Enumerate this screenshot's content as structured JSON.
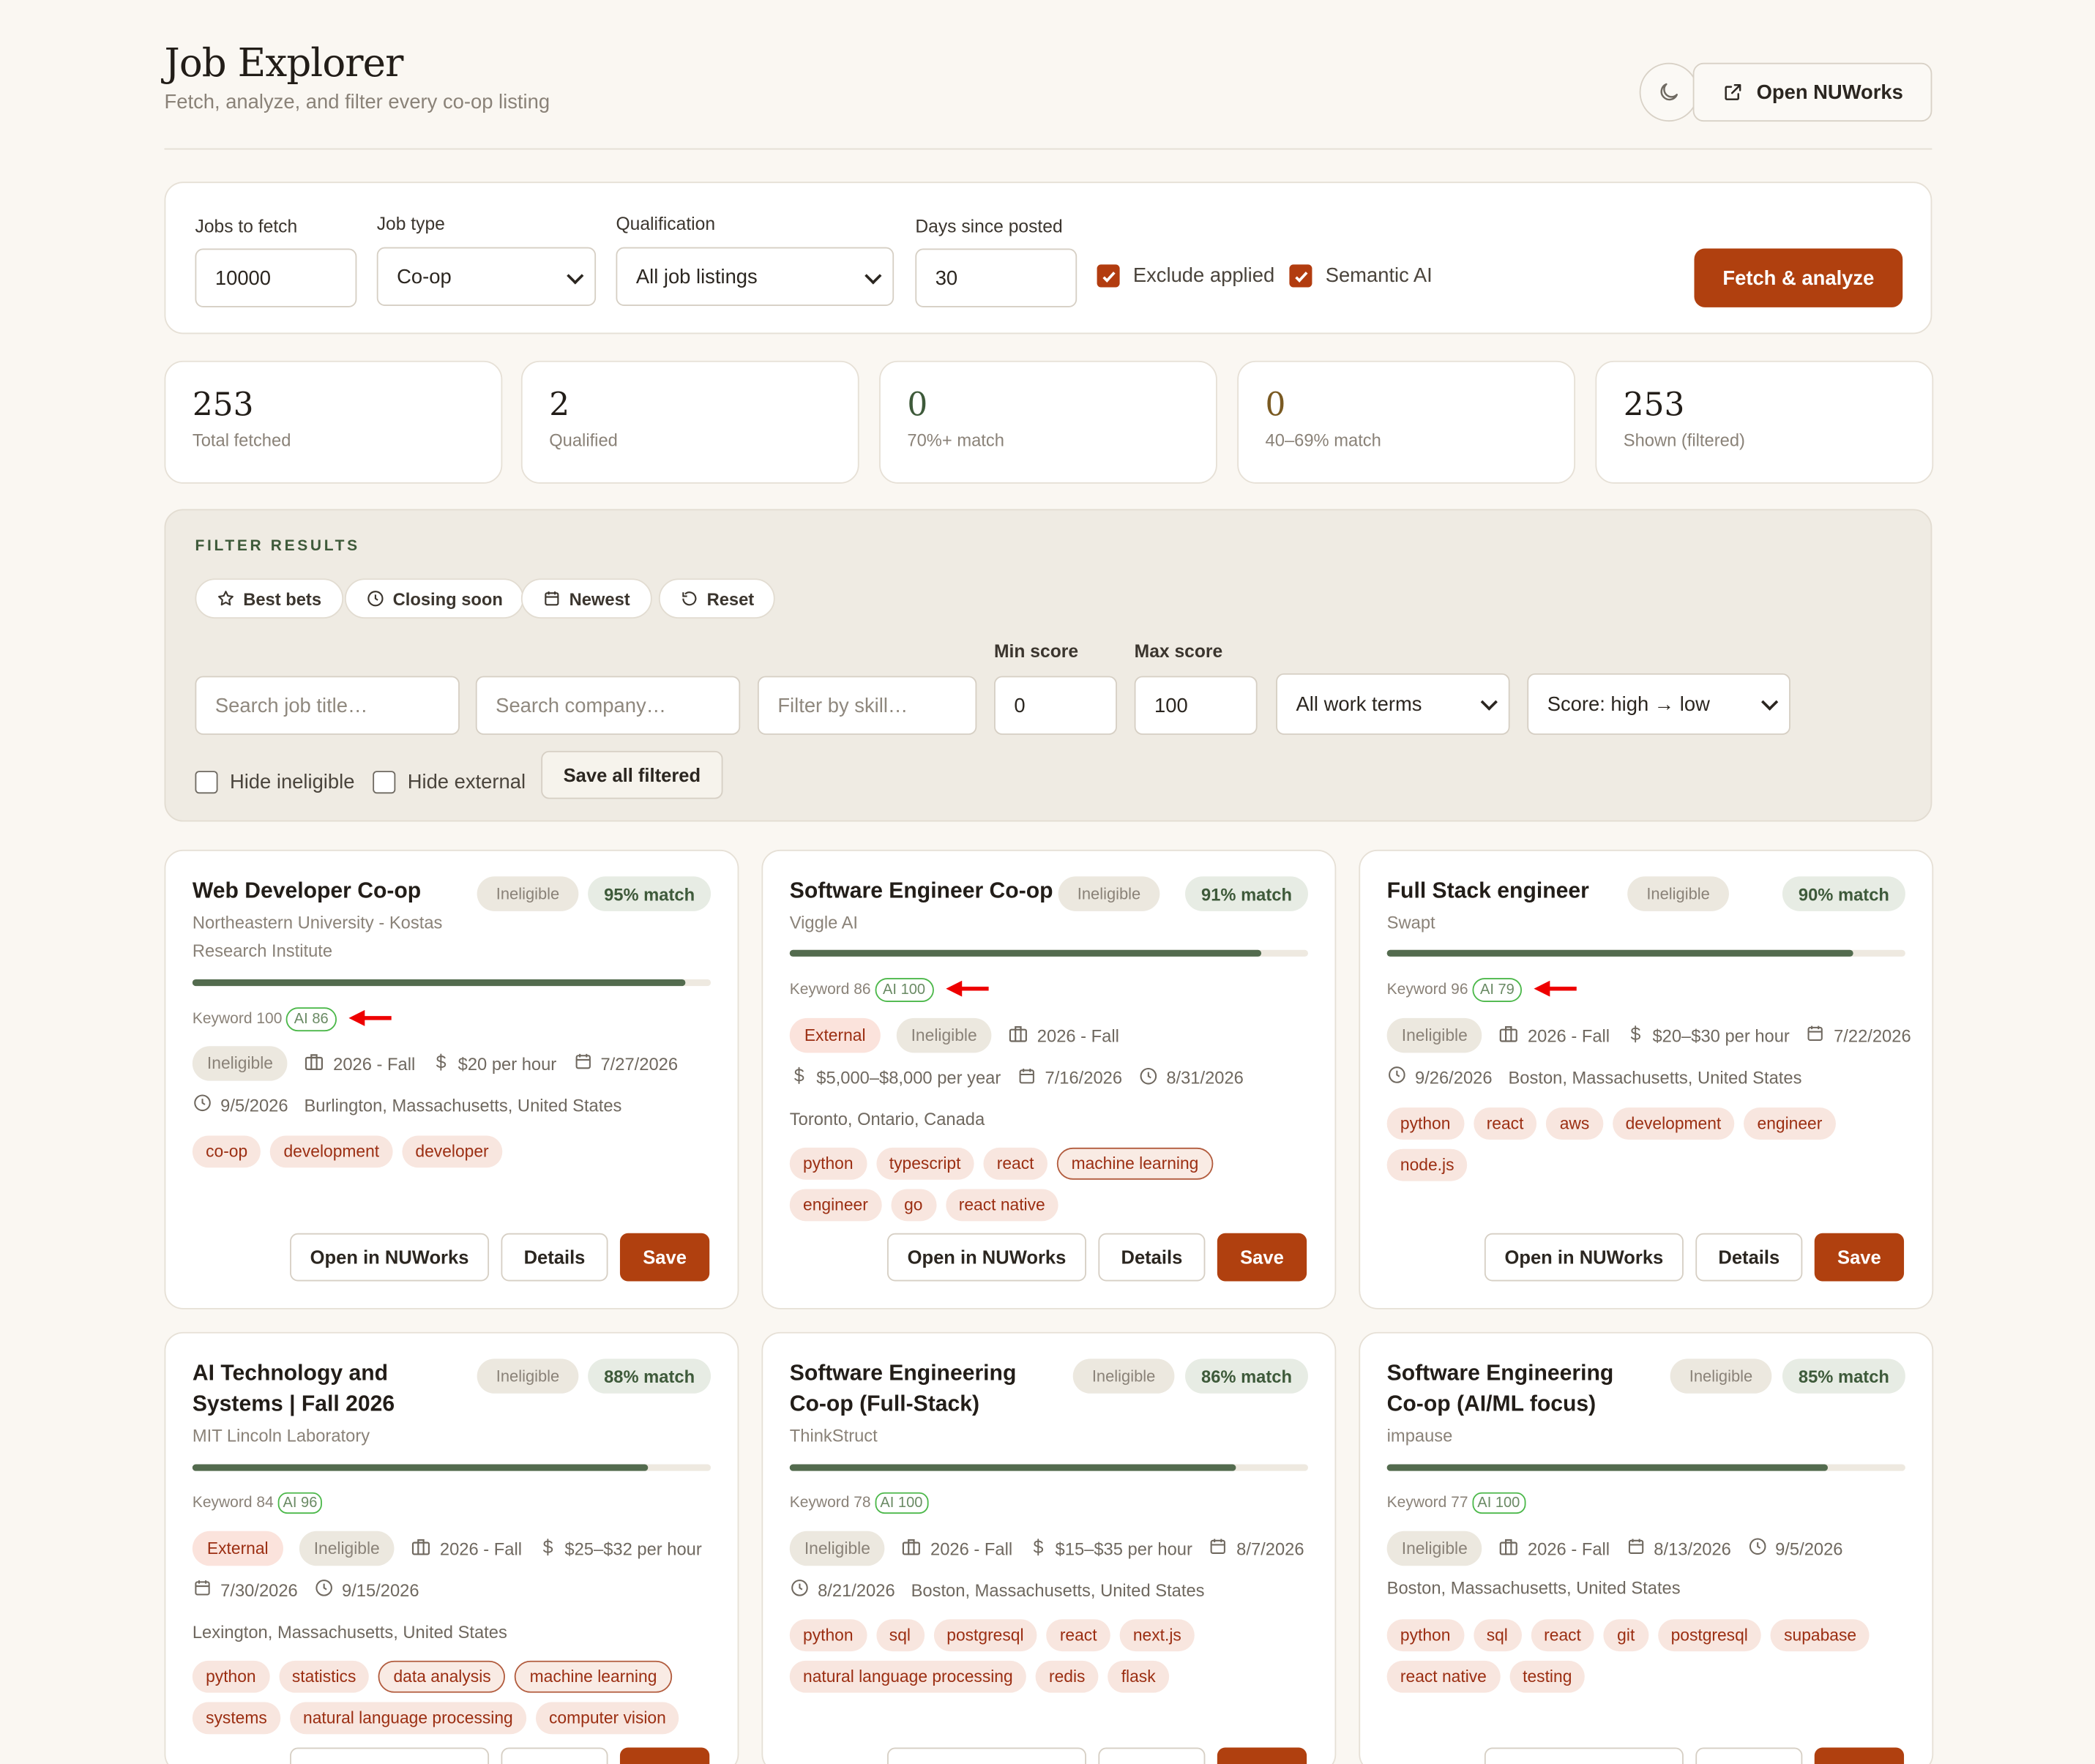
{
  "header": {
    "title": "Job Explorer",
    "subtitle": "Fetch, analyze, and filter every co-op listing",
    "open_button": "Open NUWorks",
    "theme_icon": "moon-icon"
  },
  "fetch": {
    "jobs_to_fetch_label": "Jobs to fetch",
    "jobs_to_fetch_value": "10000",
    "job_type_label": "Job type",
    "job_type_value": "Co-op",
    "qualification_label": "Qualification",
    "qualification_value": "All job listings",
    "days_label": "Days since posted",
    "days_value": "30",
    "exclude_applied_label": "Exclude applied",
    "exclude_applied_checked": true,
    "semantic_ai_label": "Semantic AI",
    "semantic_ai_checked": true,
    "fetch_button": "Fetch & analyze"
  },
  "stats": [
    {
      "value": "253",
      "label": "Total fetched"
    },
    {
      "value": "2",
      "label": "Qualified"
    },
    {
      "value": "0",
      "label": "70%+ match"
    },
    {
      "value": "0",
      "label": "40–69% match"
    },
    {
      "value": "253",
      "label": "Shown (filtered)"
    }
  ],
  "filters": {
    "title": "FILTER RESULTS",
    "chips": [
      "Best bets",
      "Closing soon",
      "Newest",
      "Reset"
    ],
    "search_title_placeholder": "Search job title…",
    "search_company_placeholder": "Search company…",
    "filter_skill_placeholder": "Filter by skill…",
    "min_score_label": "Min score",
    "min_score_value": "0",
    "max_score_label": "Max score",
    "max_score_value": "100",
    "work_terms_value": "All work terms",
    "sort_value": "Score: high → low",
    "hide_ineligible_label": "Hide ineligible",
    "hide_external_label": "Hide external",
    "save_all_button": "Save all filtered"
  },
  "card_buttons": {
    "open": "Open in NUWorks",
    "details": "Details",
    "save": "Save"
  },
  "accent_color": "#b0400f",
  "cards": [
    {
      "title": "Web Developer Co-op",
      "company": "Northeastern University - Kostas Research Institute",
      "status": "Ineligible",
      "match": "95% match",
      "score": 0.95,
      "keyword": "Keyword 100",
      "ai": "AI 86",
      "pill_inel": "Ineligible",
      "term": "2026 - Fall",
      "pay": "$20 per hour",
      "date1": "7/27/2026",
      "date2": "9/5/2026",
      "location": "Burlington, Massachusetts, United States",
      "tags": [
        "co-op",
        "development",
        "developer"
      ]
    },
    {
      "title": "Software Engineer Co-op",
      "company": "Viggle AI",
      "status": "Ineligible",
      "match": "91% match",
      "score": 0.91,
      "keyword": "Keyword 86",
      "ai": "AI 100",
      "pill_ext": "External",
      "pill_inel": "Ineligible",
      "term": "2026 - Fall",
      "pay": "$5,000–$8,000 per year",
      "date1": "7/16/2026",
      "date2": "8/31/2026",
      "location": "Toronto, Ontario, Canada",
      "tags": [
        "python",
        "typescript",
        "react",
        "machine learning",
        "engineer",
        "go",
        "react native"
      ]
    },
    {
      "title": "Full Stack engineer",
      "company": "Swapt",
      "status": "Ineligible",
      "match": "90% match",
      "score": 0.9,
      "keyword": "Keyword 96",
      "ai": "AI 79",
      "pill_inel": "Ineligible",
      "term": "2026 - Fall",
      "pay": "$20–$30 per hour",
      "date1": "7/22/2026",
      "date2": "9/26/2026",
      "location": "Boston, Massachusetts, United States",
      "tags": [
        "python",
        "react",
        "aws",
        "development",
        "engineer",
        "node.js"
      ]
    },
    {
      "title": "AI Technology and Systems | Fall 2026",
      "company": "MIT Lincoln Laboratory",
      "status": "Ineligible",
      "match": "88% match",
      "score": 0.88,
      "keyword": "Keyword 84",
      "ai": "AI 96",
      "pill_ext": "External",
      "pill_inel": "Ineligible",
      "term": "2026 - Fall",
      "pay": "$25–$32 per hour",
      "date1": "7/30/2026",
      "date2": "9/15/2026",
      "location": "Lexington, Massachusetts, United States",
      "tags": [
        "python",
        "statistics",
        "data analysis",
        "machine learning",
        "systems",
        "natural language processing",
        "computer vision"
      ]
    },
    {
      "title": "Software Engineering Co-op (Full-Stack)",
      "company": "ThinkStruct",
      "status": "Ineligible",
      "match": "86% match",
      "score": 0.86,
      "keyword": "Keyword 78",
      "ai": "AI 100",
      "pill_inel": "Ineligible",
      "term": "2026 - Fall",
      "pay": "$15–$35 per hour",
      "date1": "8/7/2026",
      "date2": "8/21/2026",
      "location": "Boston, Massachusetts, United States",
      "tags": [
        "python",
        "sql",
        "postgresql",
        "react",
        "next.js",
        "natural language processing",
        "redis",
        "flask"
      ]
    },
    {
      "title": "Software Engineering Co-op (AI/ML focus)",
      "company": "impause",
      "status": "Ineligible",
      "match": "85% match",
      "score": 0.85,
      "keyword": "Keyword 77",
      "ai": "AI 100",
      "pill_inel": "Ineligible",
      "term": "2026 - Fall",
      "date1": "8/13/2026",
      "date2": "9/5/2026",
      "location": "Boston, Massachusetts, United States",
      "tags": [
        "python",
        "sql",
        "react",
        "git",
        "postgresql",
        "supabase",
        "react native",
        "testing"
      ]
    }
  ]
}
